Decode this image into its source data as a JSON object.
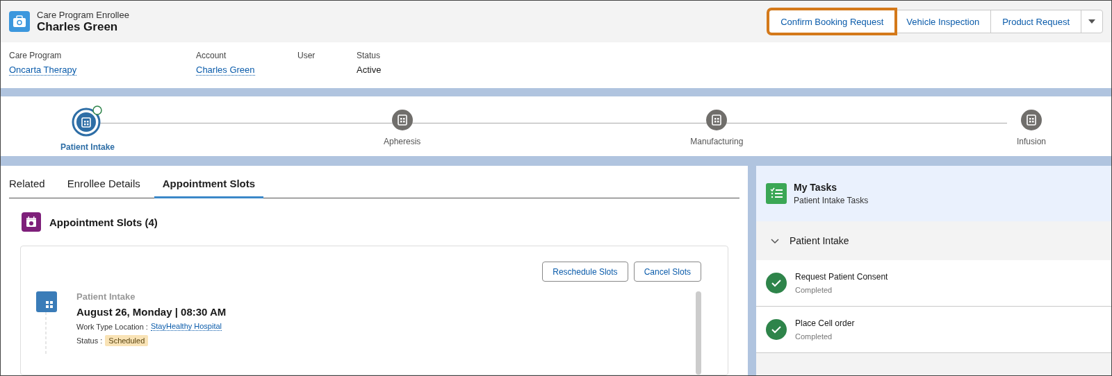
{
  "record": {
    "object_type": "Care Program Enrollee",
    "name": "Charles Green"
  },
  "actions": [
    {
      "label": "Confirm Booking Request",
      "highlighted": true
    },
    {
      "label": "Vehicle Inspection",
      "highlighted": false
    },
    {
      "label": "Product Request",
      "highlighted": false
    }
  ],
  "fields": [
    {
      "label": "Care Program",
      "value": "Oncarta Therapy",
      "kind": "link"
    },
    {
      "label": "Account",
      "value": "Charles Green",
      "kind": "link"
    },
    {
      "label": "User",
      "kind": "empty"
    },
    {
      "label": "Status",
      "value": "Active",
      "kind": "text"
    }
  ],
  "path": [
    {
      "label": "Patient Intake",
      "selected": true
    },
    {
      "label": "Apheresis",
      "selected": false
    },
    {
      "label": "Manufacturing",
      "selected": false
    },
    {
      "label": "Infusion",
      "selected": false
    }
  ],
  "tabs": [
    {
      "label": "Related",
      "selected": false
    },
    {
      "label": "Enrollee Details",
      "selected": false
    },
    {
      "label": "Appointment Slots",
      "selected": true
    }
  ],
  "appointment_slots": {
    "title": "Appointment Slots (4)",
    "buttons": [
      "Reschedule Slots",
      "Cancel Slots"
    ],
    "items": [
      {
        "type": "Patient Intake",
        "datetime": "August 26, Monday | 08:30 AM",
        "location_label": "Work Type Location :",
        "location": "StayHealthy Hospital",
        "status_label": "Status :",
        "status": "Scheduled"
      }
    ]
  },
  "tasks": {
    "title": "My Tasks",
    "subtitle": "Patient Intake Tasks",
    "section": {
      "label": "Patient Intake",
      "expanded": true
    },
    "items": [
      {
        "name": "Request Patient Consent",
        "status": "Completed",
        "completed": true
      },
      {
        "name": "Place Cell order",
        "status": "Completed",
        "completed": true
      }
    ]
  }
}
